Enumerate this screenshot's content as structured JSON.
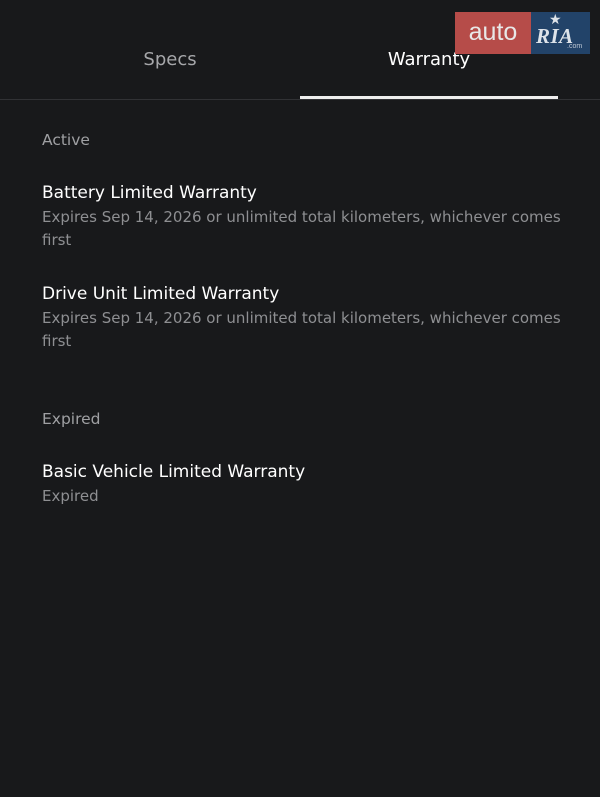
{
  "tabs": [
    {
      "label": "Specs",
      "active": false
    },
    {
      "label": "Warranty",
      "active": true
    }
  ],
  "sections": [
    {
      "header": "Active",
      "items": [
        {
          "title": "Battery Limited Warranty",
          "subtitle": "Expires Sep 14, 2026 or unlimited total kilometers, whichever comes first"
        },
        {
          "title": "Drive Unit Limited Warranty",
          "subtitle": "Expires Sep 14, 2026 or unlimited total kilometers, whichever comes first"
        }
      ]
    },
    {
      "header": "Expired",
      "items": [
        {
          "title": "Basic Vehicle Limited Warranty",
          "subtitle": "Expired"
        }
      ]
    }
  ],
  "watermark": {
    "text_auto": "auto",
    "text_ria": "RIA",
    "text_com": ".com",
    "colors": {
      "auto_bg": "#c8524f",
      "ria_bg": "#23466e"
    }
  },
  "colors": {
    "background": "#18191b",
    "text_primary": "#ffffff",
    "text_secondary": "#8e8f92",
    "indicator": "#eeeeee"
  }
}
